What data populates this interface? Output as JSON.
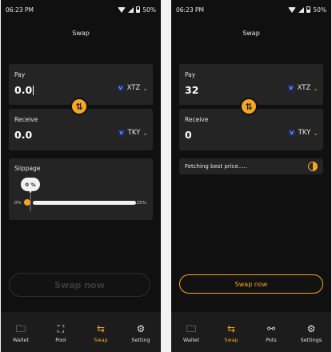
{
  "left": {
    "status_time": "06:23 PM",
    "battery": "50%",
    "title": "Swap",
    "pay": {
      "label": "Pay",
      "value": "0.0",
      "token": "XTZ"
    },
    "receive": {
      "label": "Receive",
      "value": "0.0",
      "token": "TKY"
    },
    "slippage": {
      "label": "Slippage",
      "value": "0 %",
      "min": "0%",
      "max": "25%",
      "level_percent": 0
    },
    "swap_button": "Swap now",
    "nav": [
      {
        "label": "Wallet",
        "icon": "wallet-icon",
        "glyph": "🗀"
      },
      {
        "label": "Pool",
        "icon": "pool-icon",
        "glyph": "⛶"
      },
      {
        "label": "Swap",
        "icon": "swap-arrows-icon",
        "glyph": "⇆",
        "active": true
      },
      {
        "label": "Setting",
        "icon": "settings-gear-icon",
        "glyph": "⚙"
      }
    ]
  },
  "right": {
    "status_time": "06:23 PM",
    "battery": "50%",
    "title": "Swap",
    "pay": {
      "label": "Pay",
      "value": "32",
      "token": "XTZ"
    },
    "receive": {
      "label": "Receive",
      "value": "0",
      "token": "TKY"
    },
    "status": "Fetching best price.....",
    "swap_button": "Swap now",
    "nav": [
      {
        "label": "Wallet",
        "icon": "wallet-icon",
        "glyph": "🗀"
      },
      {
        "label": "Swap",
        "icon": "swap-arrows-icon",
        "glyph": "⇆",
        "active": true
      },
      {
        "label": "Pots",
        "icon": "pots-icon",
        "glyph": "⚯"
      },
      {
        "label": "Settings",
        "icon": "settings-gear-icon",
        "glyph": "⚙"
      }
    ]
  },
  "colors": {
    "accent": "#f5a623",
    "background": "#101010",
    "card": "#242424"
  }
}
